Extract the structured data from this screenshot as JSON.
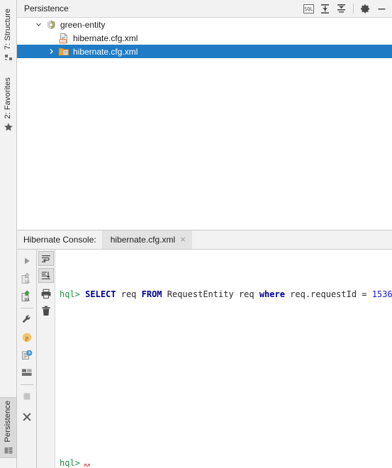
{
  "tool_window": {
    "title": "Persistence",
    "actions": [
      {
        "name": "open-console-icon",
        "label": "Open Console",
        "glyph": "sql"
      },
      {
        "name": "expand-all-icon",
        "label": "Expand All",
        "glyph": "expand"
      },
      {
        "name": "collapse-all-icon",
        "label": "Collapse All",
        "glyph": "collapse"
      },
      {
        "name": "settings-gear-icon",
        "label": "Settings",
        "glyph": "gear"
      },
      {
        "name": "hide-window-icon",
        "label": "Hide",
        "glyph": "minus"
      }
    ]
  },
  "tree": {
    "nodes": [
      {
        "label": "green-entity",
        "icon": "persistence-unit-icon",
        "indent": 0,
        "twisty": "expanded",
        "selected": false
      },
      {
        "label": "hibernate.cfg.xml",
        "icon": "xml-file-icon",
        "indent": 1,
        "twisty": "none",
        "selected": false
      },
      {
        "label": "hibernate.cfg.xml",
        "icon": "session-factory-icon",
        "indent": 1,
        "twisty": "collapsed",
        "selected": true
      }
    ]
  },
  "console": {
    "title": "Hibernate Console:",
    "tab": {
      "label": "hibernate.cfg.xml",
      "close": "×"
    },
    "run_toolbar": [
      {
        "name": "execute-button",
        "label": "Execute",
        "glyph": "play"
      },
      {
        "name": "generate-sql-button",
        "label": "Generate SQL",
        "glyph": "sql-gen"
      },
      {
        "name": "generate-ddl-button",
        "label": "Generate DDL",
        "glyph": "ddl-gen"
      },
      {
        "name": "configure-button",
        "label": "Configure",
        "glyph": "wrench"
      },
      {
        "name": "parameters-button",
        "label": "Parameters",
        "glyph": "param"
      },
      {
        "name": "history-button",
        "label": "History",
        "glyph": "history"
      },
      {
        "name": "layout-button",
        "label": "Change Layout",
        "glyph": "layout"
      },
      {
        "name": "stop-button",
        "label": "Stop",
        "glyph": "stop"
      },
      {
        "name": "close-button",
        "label": "Close",
        "glyph": "x"
      }
    ],
    "gutter": [
      {
        "name": "soft-wrap-icon",
        "label": "Soft-Wrap",
        "glyph": "wrap"
      },
      {
        "name": "scroll-to-end-icon",
        "label": "Scroll to End",
        "glyph": "scroll-end"
      },
      {
        "name": "print-icon",
        "label": "Print",
        "glyph": "print"
      },
      {
        "name": "clear-all-icon",
        "label": "Clear All",
        "glyph": "trash"
      }
    ],
    "lines": [
      {
        "prompt": "hql>",
        "tokens": [
          {
            "text": " ",
            "type": "plain"
          },
          {
            "text": "SELECT",
            "type": "kw"
          },
          {
            "text": " req ",
            "type": "plain"
          },
          {
            "text": "FROM",
            "type": "kw"
          },
          {
            "text": " RequestEntity req ",
            "type": "plain"
          },
          {
            "text": "where",
            "type": "kw"
          },
          {
            "text": " req.requestId = ",
            "type": "plain"
          },
          {
            "text": "1536",
            "type": "num"
          }
        ]
      },
      {
        "prompt": "",
        "tokens": []
      },
      {
        "prompt": "",
        "tokens": []
      },
      {
        "prompt": "",
        "tokens": []
      },
      {
        "prompt": "hql>",
        "tokens": [],
        "error_marker": true
      }
    ]
  },
  "stripe": {
    "top_items": [
      {
        "name": "sidebar-item-structure",
        "label": "7: Structure",
        "icon": "structure-icon"
      },
      {
        "name": "sidebar-item-favorites",
        "label": "2: Favorites",
        "icon": "star-icon"
      }
    ],
    "bottom_items": [
      {
        "name": "sidebar-item-persistence",
        "label": "Persistence",
        "icon": "persistence-icon",
        "active": true
      }
    ]
  },
  "colors": {
    "selection": "#1f7cc4",
    "panel": "#f2f2f2",
    "editor_bg": "#ffffff",
    "keyword": "#000096",
    "number": "#1a1ae0",
    "prompt": "#1d8f3f",
    "error": "#e05151"
  }
}
